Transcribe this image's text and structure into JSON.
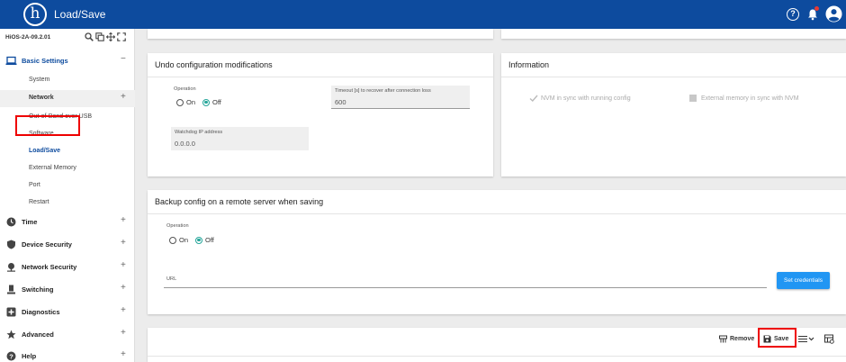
{
  "header": {
    "logo_glyph": "h",
    "title": "Load/Save",
    "help_glyph": "?"
  },
  "sidebar": {
    "device_name": "HiOS-2A-09.2.01",
    "sections": [
      {
        "label": "Basic Settings",
        "icon": "laptop-icon",
        "toggle": "−",
        "expanded": true
      },
      {
        "label": "Time",
        "icon": "clock-icon",
        "toggle": "+"
      },
      {
        "label": "Device Security",
        "icon": "shield-icon",
        "toggle": "+"
      },
      {
        "label": "Network Security",
        "icon": "network-icon",
        "toggle": "+"
      },
      {
        "label": "Switching",
        "icon": "switching-icon",
        "toggle": "+"
      },
      {
        "label": "Diagnostics",
        "icon": "plus-box-icon",
        "toggle": "+"
      },
      {
        "label": "Advanced",
        "icon": "star-icon",
        "toggle": "+"
      },
      {
        "label": "Help",
        "icon": "help-circle-icon",
        "toggle": "+"
      }
    ],
    "basic_items": [
      {
        "label": "System"
      },
      {
        "label": "Network",
        "toggle": "+"
      },
      {
        "label": "Out-of-Band over USB"
      },
      {
        "label": "Software"
      },
      {
        "label": "Load/Save",
        "active": true
      },
      {
        "label": "External Memory"
      },
      {
        "label": "Port"
      },
      {
        "label": "Restart"
      }
    ]
  },
  "undo_card": {
    "title": "Undo configuration modifications",
    "operation_label": "Operation",
    "on_label": "On",
    "off_label": "Off",
    "selected": "Off",
    "timeout_label": "Timeout [s] to recover after connection loss",
    "timeout_value": "600",
    "watchdog_label": "Watchdog IP address",
    "watchdog_value": "0.0.0.0"
  },
  "info_card": {
    "title": "Information",
    "nvm_label": "NVM in sync with running config",
    "ext_label": "External memory in sync with NVM"
  },
  "backup_card": {
    "title": "Backup config on a remote server when saving",
    "operation_label": "Operation",
    "on_label": "On",
    "off_label": "Off",
    "selected": "Off",
    "url_label": "URL",
    "credentials_button": "Set credentials"
  },
  "toolbar": {
    "remove_label": "Remove",
    "save_label": "Save"
  },
  "colors": {
    "header": "#0d4b9e",
    "accent": "#26a69a",
    "button": "#2196f3",
    "highlight": "#ee0000"
  }
}
